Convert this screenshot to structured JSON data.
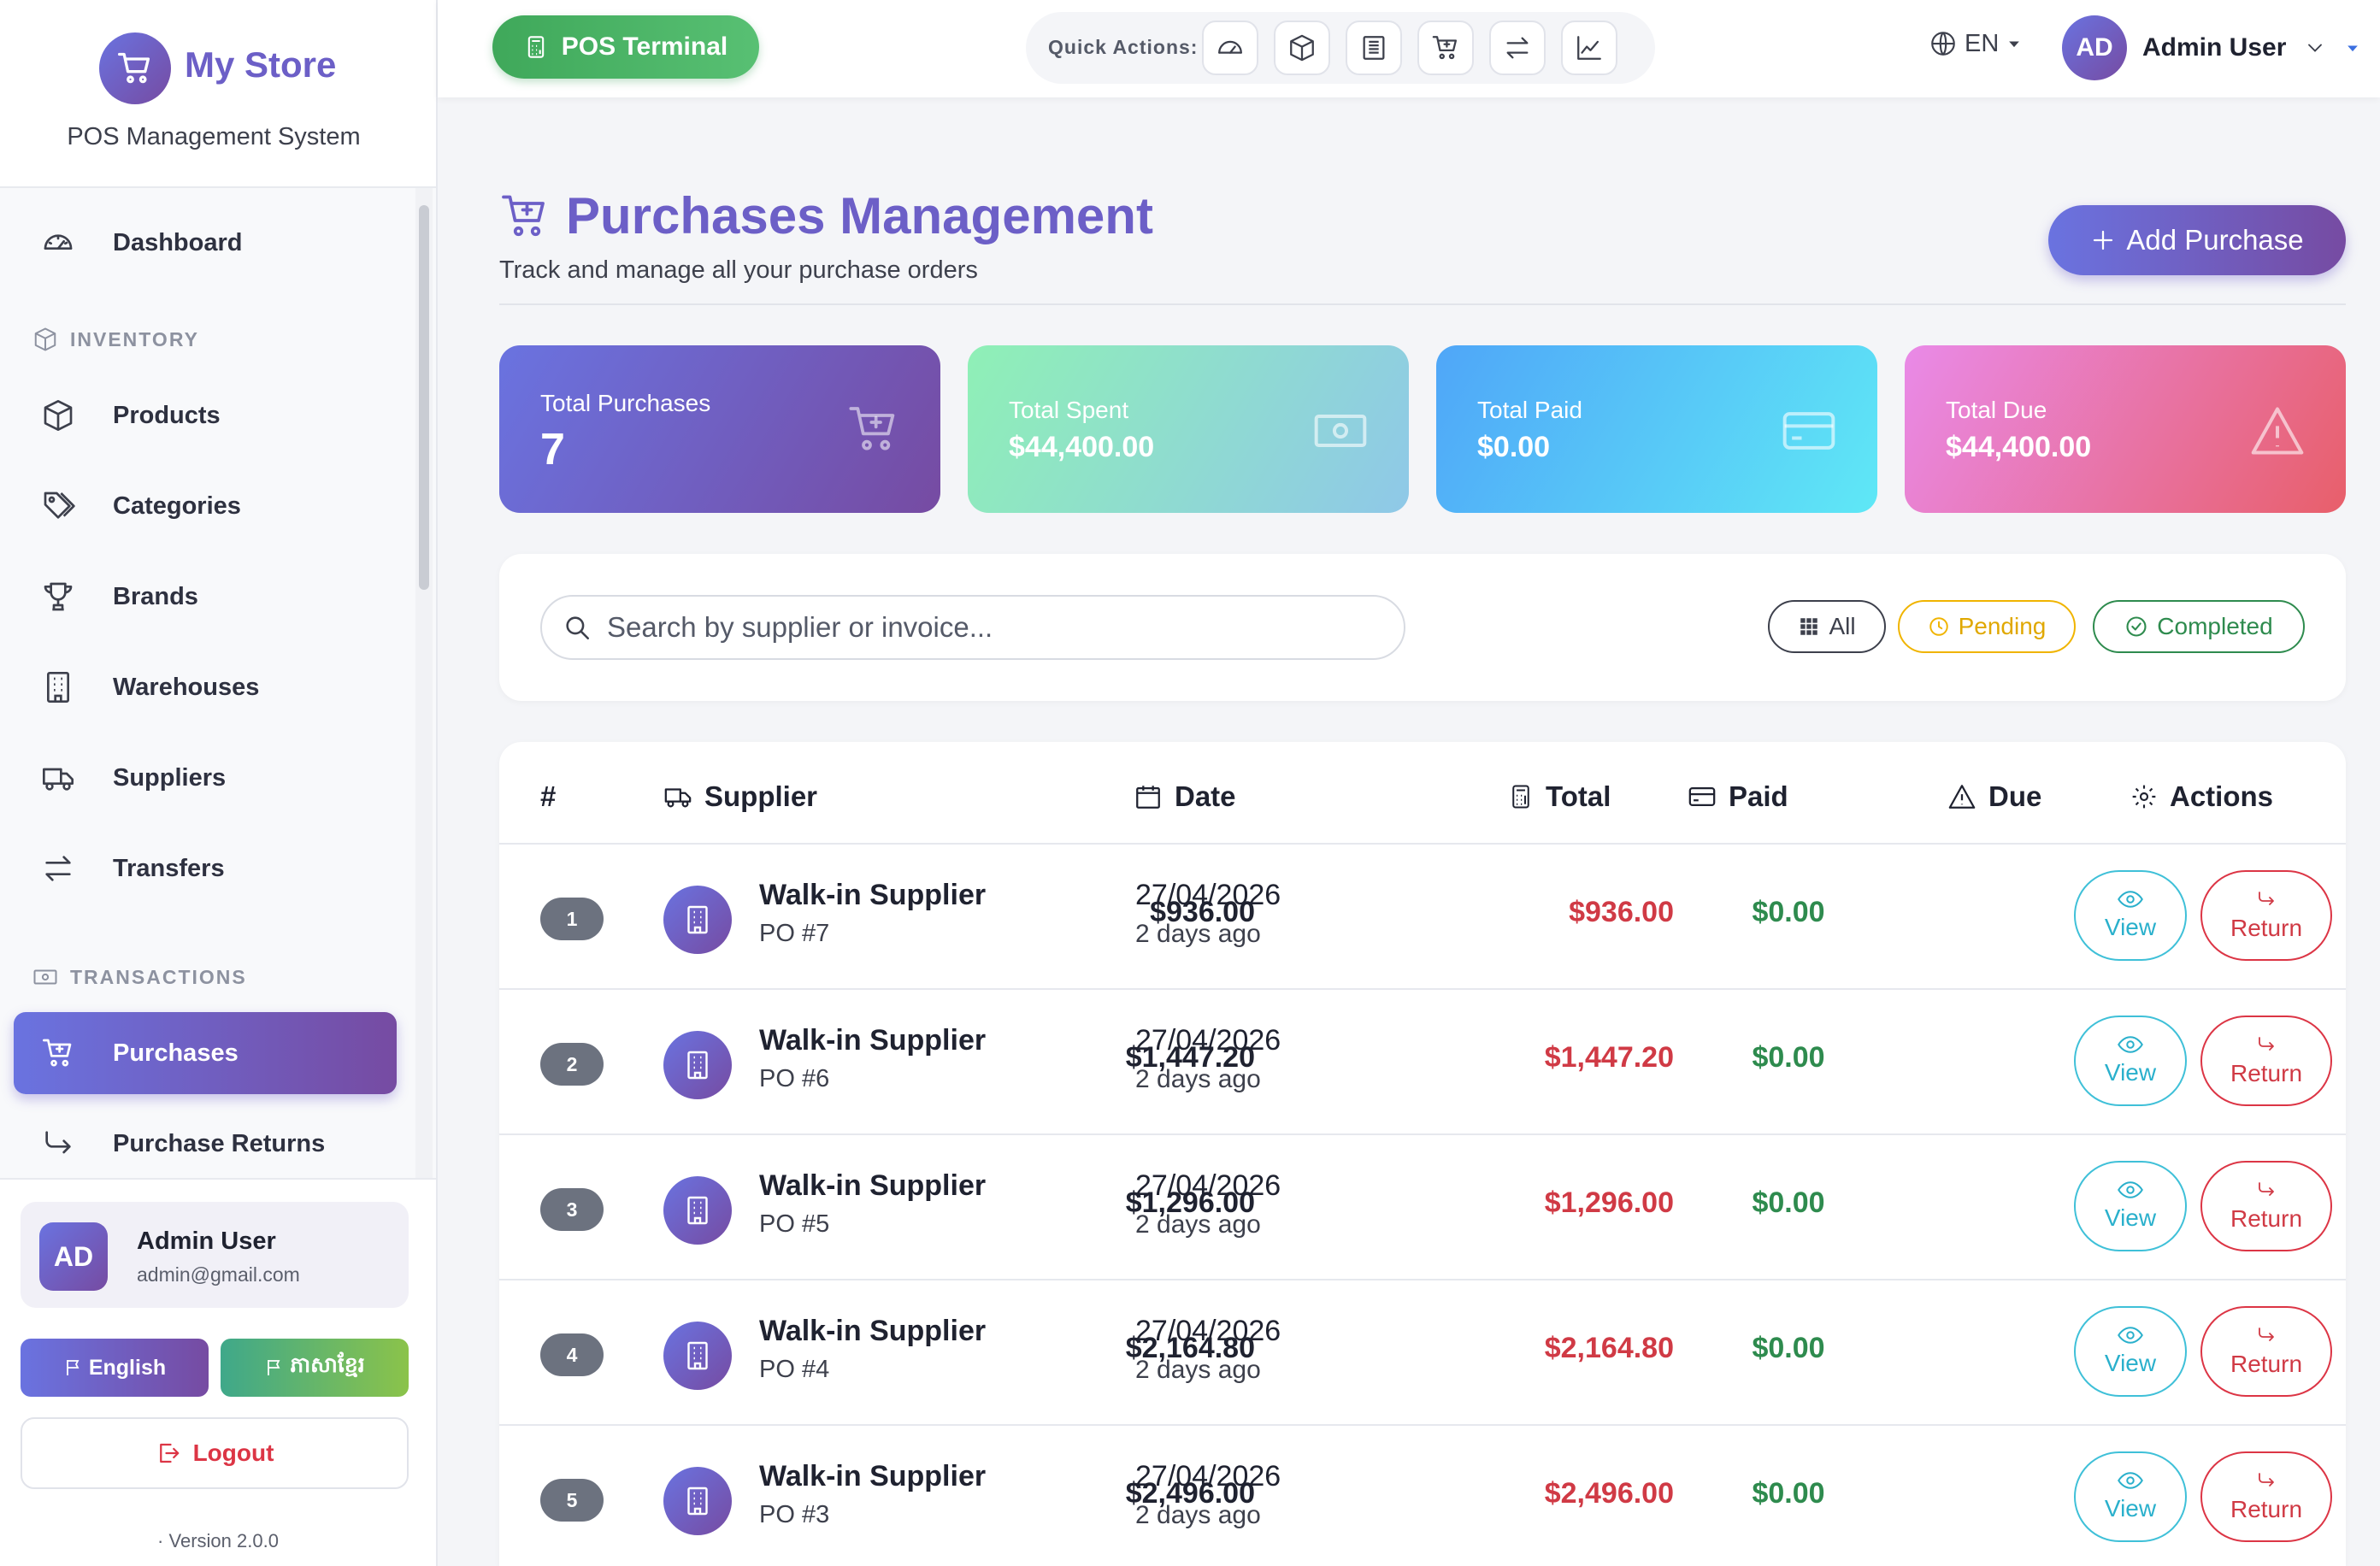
{
  "brand": {
    "name": "My Store",
    "subtitle": "POS Management System"
  },
  "sidebar": {
    "items": [
      {
        "label": "Dashboard",
        "icon": "speedometer-icon"
      },
      {
        "section": "INVENTORY",
        "icon": "box-icon"
      },
      {
        "label": "Products",
        "icon": "box-icon"
      },
      {
        "label": "Categories",
        "icon": "tags-icon"
      },
      {
        "label": "Brands",
        "icon": "trophy-icon"
      },
      {
        "label": "Warehouses",
        "icon": "building-icon"
      },
      {
        "label": "Suppliers",
        "icon": "truck-icon"
      },
      {
        "label": "Transfers",
        "icon": "arrows-icon"
      },
      {
        "section": "TRANSACTIONS",
        "icon": "cash-icon"
      },
      {
        "label": "Purchases",
        "icon": "cart-plus-icon",
        "active": true
      },
      {
        "label": "Purchase Returns",
        "icon": "return-arrow-icon"
      }
    ],
    "user": {
      "initials": "AD",
      "name": "Admin User",
      "email": "admin@gmail.com"
    },
    "lang_english": "English",
    "lang_khmer": "ភាសាខ្មែរ",
    "logout": "Logout",
    "version": "Version 2.0.0"
  },
  "topbar": {
    "pos_button": "POS Terminal",
    "quick_actions_label": "Quick Actions:",
    "quick_actions": [
      "speedometer-icon",
      "box-icon",
      "receipt-icon",
      "cart-plus-icon",
      "arrows-icon",
      "chart-icon"
    ],
    "language": "EN",
    "user_initials": "AD",
    "user_name": "Admin User"
  },
  "page": {
    "title": "Purchases Management",
    "subtitle": "Track and manage all your purchase orders",
    "add_button": "Add Purchase"
  },
  "stats": [
    {
      "label": "Total Purchases",
      "value": "7",
      "icon": "cart-plus-icon"
    },
    {
      "label": "Total Spent",
      "value": "$44,400.00",
      "icon": "cash-icon"
    },
    {
      "label": "Total Paid",
      "value": "$0.00",
      "icon": "credit-card-icon"
    },
    {
      "label": "Total Due",
      "value": "$44,400.00",
      "icon": "warning-icon"
    }
  ],
  "filters": {
    "search_placeholder": "Search by supplier or invoice...",
    "all": "All",
    "pending": "Pending",
    "completed": "Completed"
  },
  "table": {
    "headers": {
      "num": "#",
      "supplier": "Supplier",
      "date": "Date",
      "total": "Total",
      "paid": "Paid",
      "due": "Due",
      "actions": "Actions"
    },
    "view_label": "View",
    "return_label": "Return",
    "rows": [
      {
        "num": "1",
        "supplier": "Walk-in Supplier",
        "po": "PO #7",
        "date": "27/04/2026",
        "ago": "2 days ago",
        "total": "$936.00",
        "paid": "$0.00",
        "due": "$936.00"
      },
      {
        "num": "2",
        "supplier": "Walk-in Supplier",
        "po": "PO #6",
        "date": "27/04/2026",
        "ago": "2 days ago",
        "total": "$1,447.20",
        "paid": "$0.00",
        "due": "$1,447.20"
      },
      {
        "num": "3",
        "supplier": "Walk-in Supplier",
        "po": "PO #5",
        "date": "27/04/2026",
        "ago": "2 days ago",
        "total": "$1,296.00",
        "paid": "$0.00",
        "due": "$1,296.00"
      },
      {
        "num": "4",
        "supplier": "Walk-in Supplier",
        "po": "PO #4",
        "date": "27/04/2026",
        "ago": "2 days ago",
        "total": "$2,164.80",
        "paid": "$0.00",
        "due": "$2,164.80"
      },
      {
        "num": "5",
        "supplier": "Walk-in Supplier",
        "po": "PO #3",
        "date": "27/04/2026",
        "ago": "2 days ago",
        "total": "$2,496.00",
        "paid": "$0.00",
        "due": "$2,496.00"
      }
    ]
  },
  "colors": {
    "accent": "#6c5fc7",
    "success": "#2e8b4e",
    "danger": "#d03a45",
    "info": "#2ab0cc",
    "pending": "#f0b400"
  }
}
